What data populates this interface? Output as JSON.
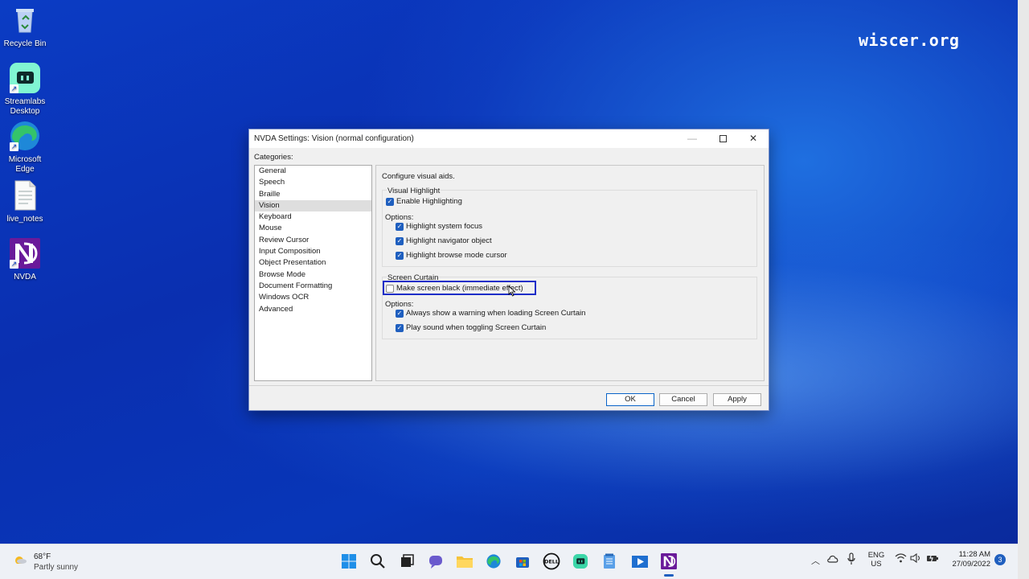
{
  "watermark": "wiscer.org",
  "desktop_icons": [
    {
      "label": "Recycle Bin",
      "icon": "recycle-bin-icon"
    },
    {
      "label": "Streamlabs Desktop",
      "icon": "streamlabs-icon"
    },
    {
      "label": "Microsoft Edge",
      "icon": "edge-icon"
    },
    {
      "label": "live_notes",
      "icon": "text-file-icon"
    },
    {
      "label": "NVDA",
      "icon": "nvda-icon"
    }
  ],
  "dialog": {
    "title": "NVDA Settings: Vision (normal configuration)",
    "categories_label": "Categories:",
    "categories": [
      "General",
      "Speech",
      "Braille",
      "Vision",
      "Keyboard",
      "Mouse",
      "Review Cursor",
      "Input Composition",
      "Object Presentation",
      "Browse Mode",
      "Document Formatting",
      "Windows OCR",
      "Advanced"
    ],
    "selected_category": "Vision",
    "panel": {
      "description": "Configure visual aids.",
      "visual_highlight": {
        "group_label": "Visual Highlight",
        "enable_label": "Enable Highlighting",
        "enable_checked": true,
        "options_label": "Options:",
        "options": [
          {
            "label": "Highlight system focus",
            "checked": true
          },
          {
            "label": "Highlight navigator object",
            "checked": true
          },
          {
            "label": "Highlight browse mode cursor",
            "checked": true
          }
        ]
      },
      "screen_curtain": {
        "group_label": "Screen Curtain",
        "make_black_label": "Make screen black (immediate effect)",
        "make_black_checked": false,
        "options_label": "Options:",
        "options": [
          {
            "label": "Always show a warning when loading Screen Curtain",
            "checked": true
          },
          {
            "label": "Play sound when toggling Screen Curtain",
            "checked": true
          }
        ]
      }
    },
    "buttons": {
      "ok": "OK",
      "cancel": "Cancel",
      "apply": "Apply"
    }
  },
  "taskbar": {
    "weather_temp": "68°F",
    "weather_desc": "Partly sunny",
    "apps": [
      "start-icon",
      "search-icon",
      "task-view-icon",
      "chat-icon",
      "file-explorer-icon",
      "edge-icon",
      "store-icon",
      "dell-icon",
      "streamlabs-icon",
      "notepad-icon",
      "media-player-icon",
      "nvda-icon"
    ],
    "lang_line1": "ENG",
    "lang_line2": "US",
    "time": "11:28 AM",
    "date": "27/09/2022",
    "notification_count": "3"
  },
  "colors": {
    "accent": "#1f5fbf",
    "highlight_box": "#1e2ec8",
    "desktop_blue": "#0a2fb8"
  }
}
